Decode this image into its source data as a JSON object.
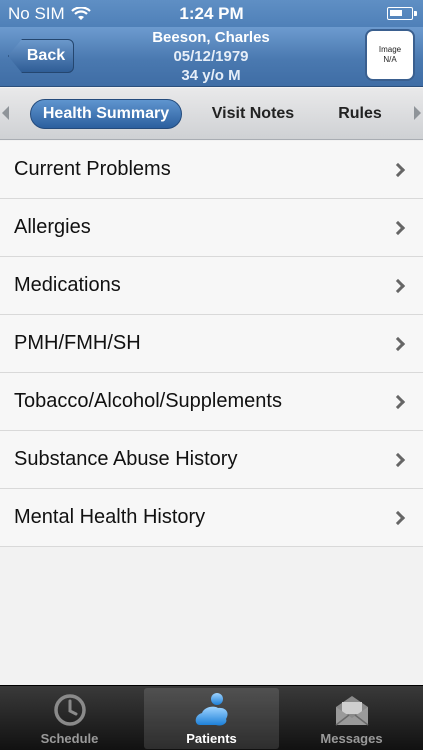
{
  "status_bar": {
    "carrier": "No SIM",
    "time": "1:24 PM"
  },
  "header": {
    "back_label": "Back",
    "patient_name": "Beeson, Charles",
    "patient_dob": "05/12/1979",
    "patient_age": "34 y/o M",
    "image_placeholder": "Image\nN/A"
  },
  "segments": [
    {
      "label": "Health Summary",
      "active": true
    },
    {
      "label": "Visit Notes",
      "active": false
    },
    {
      "label": "Rules",
      "active": false
    }
  ],
  "list_items": [
    {
      "label": "Current Problems"
    },
    {
      "label": "Allergies"
    },
    {
      "label": "Medications"
    },
    {
      "label": "PMH/FMH/SH"
    },
    {
      "label": "Tobacco/Alcohol/Supplements"
    },
    {
      "label": "Substance Abuse History"
    },
    {
      "label": "Mental Health History"
    }
  ],
  "tab_bar": {
    "schedule_label": "Schedule",
    "patients_label": "Patients",
    "messages_label": "Messages",
    "active": "Patients"
  },
  "colors": {
    "header_blue": "#4a79b0",
    "active_tab_blue": "#2c5f9e",
    "tab_bar_dark": "#111111"
  }
}
